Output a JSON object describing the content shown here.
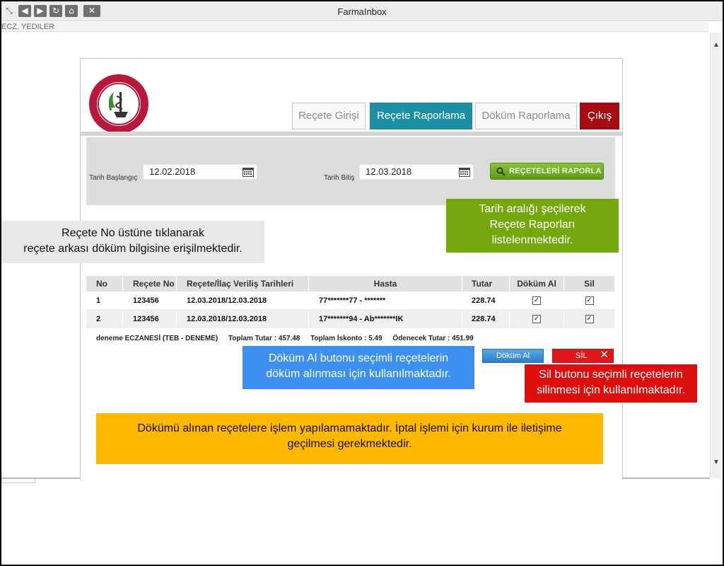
{
  "window": {
    "title": "FarmaInbox",
    "user": "ECZ. YEDILER",
    "nav_icons": [
      "restore-icon",
      "back-icon",
      "forward-icon",
      "refresh-icon",
      "home-icon",
      "close-icon"
    ]
  },
  "logo": {
    "alt": "Türk Eczacıları Birliği"
  },
  "tabs": {
    "giris": "Reçete Girişi",
    "rapor": "Reçete Raporlama",
    "dokum": "Döküm Raporlama",
    "cikis": "Çıkış"
  },
  "filter": {
    "start_label": "Tarih Başlangıç",
    "start_value": "12.02.2018",
    "end_label": "Tarih Bitiş",
    "end_value": "12.03.2018",
    "report_button": "REÇETELERİ RAPORLA"
  },
  "table": {
    "headers": [
      "No",
      "Reçete No",
      "Reçete/İlaç Veriliş Tarihleri",
      "Hasta",
      "Tutar",
      "Döküm Al",
      "Sil"
    ],
    "rows": [
      {
        "no": "1",
        "recete_no": "123456",
        "tarih": "12.03.2018/12.03.2018",
        "hasta": "77*******77 - *******",
        "tutar": "228.74",
        "dokum": "✓",
        "sil": "✓"
      },
      {
        "no": "2",
        "recete_no": "123456",
        "tarih": "12.03.2018/12.03.2018",
        "hasta": "17*******94 - Ab*******IK",
        "tutar": "228.74",
        "dokum": "✓",
        "sil": "✓"
      }
    ]
  },
  "totals": {
    "eczane": "deneme ECZANESİ (TEB - DENEME)",
    "toplam_tutar": "Toplam Tutar : 457.48",
    "toplam_iskonto": "Toplam İskonto : 5.49",
    "odenecek": "Ödenecek Tutar : 451.99"
  },
  "buttons": {
    "dokum_al": "Döküm Al",
    "sil": "SİL"
  },
  "notes": {
    "green_1": "Tarih aralığı şeçilerek",
    "green_2": "Reçete Raporları",
    "green_3": "listelenmektedir.",
    "grey_1": "Reçete No üstüne tıklanarak",
    "grey_2": "reçete arkası döküm bilgisine erişilmektedir.",
    "blue_1": "Döküm Al butonu seçimli reçetelerin",
    "blue_2": "döküm alınması için kullanılmaktadır.",
    "red_1": "Sil butonu seçimli reçetelerin",
    "red_2": "silinmesi için kullanılmaktadır.",
    "orange_1": "Dökümü alınan reçetelere işlem yapılamamaktadır. İptal işlemi için kurum ile iletişime",
    "orange_2": "geçilmesi gerekmektedir."
  },
  "colors": {
    "tab_active": "#1b8fa4",
    "exit": "#a50d12",
    "report_button": "#6fa92a",
    "note_green": "#74a80e",
    "note_blue": "#3d8ff0",
    "note_red": "#dd0e0e",
    "note_orange": "#ffb700"
  }
}
